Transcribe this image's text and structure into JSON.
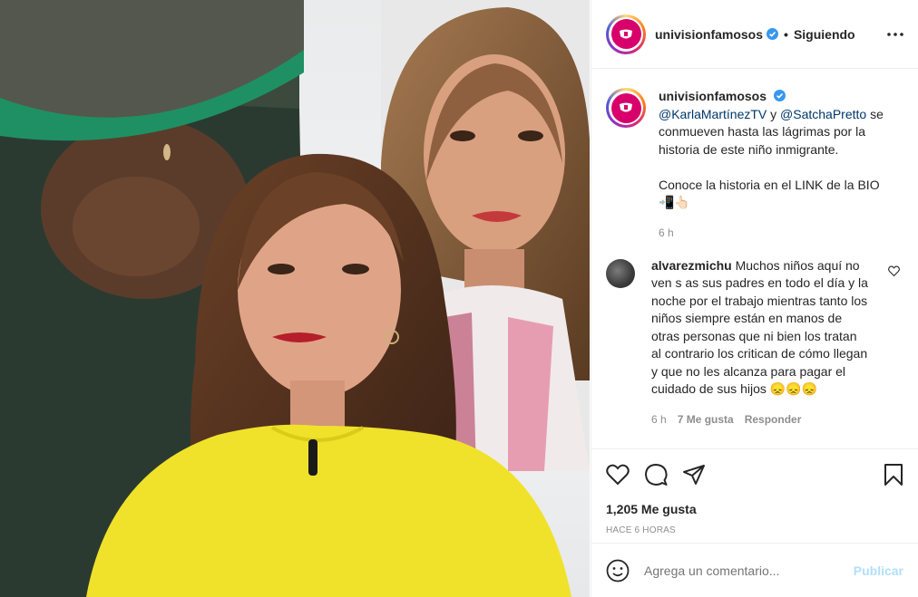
{
  "post": {
    "username": "univisionfamosos",
    "following": "Siguiendo",
    "dot": "•"
  },
  "caption": {
    "username": "univisionfamosos",
    "mention1": "@KarlaMartínezTV",
    "connector": " y ",
    "mention2": "@SatchaPretto",
    "text1": " se conmueven hasta las lágrimas por la historia de este niño inmigrante.",
    "text2": "Conoce la historia en el LINK de la BIO",
    "emojis": "📲👆🏻",
    "age": "6 h"
  },
  "comment": {
    "username": "alvarezmichu",
    "text": "Muchos niños aquí no ven s as sus padres en todo el día y la noche por el trabajo mientras tanto los niños siempre están en manos de otras personas que ni bien los tratan al contrario los critican de cómo llegan y que no les alcanza para pagar el cuidado de sus hijos",
    "emojis": "😞😞😞",
    "age": "6 h",
    "likes": "7 Me gusta",
    "reply": "Responder"
  },
  "stats": {
    "likes": "1,205 Me gusta",
    "time": "HACE 6 HORAS"
  },
  "composer": {
    "placeholder": "Agrega un comentario...",
    "post": "Publicar"
  },
  "colors": {
    "link": "#00376b",
    "verified": "#3897f0",
    "post_disabled": "#b2dffc",
    "brand": "#d8006b"
  }
}
